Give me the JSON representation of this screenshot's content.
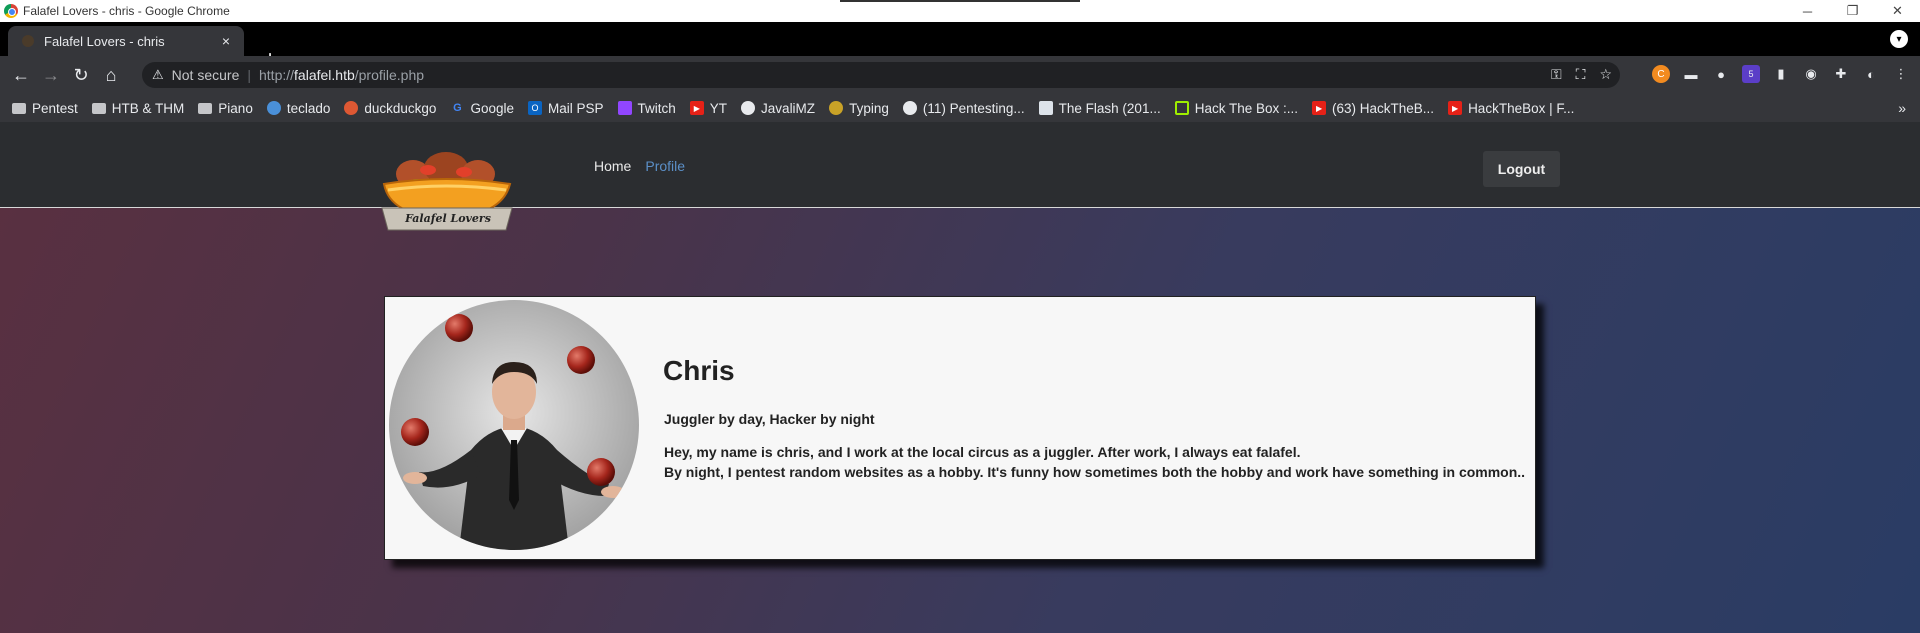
{
  "os": {
    "window_title": "Falafel Lovers - chris - Google Chrome",
    "min": "─",
    "restore": "❐",
    "close": "✕"
  },
  "browser": {
    "tab_title": "Falafel Lovers - chris",
    "tab_close": "×",
    "new_tab": "+",
    "security_label": "Not secure",
    "url_scheme": "http://",
    "url_host": "falafel.htb",
    "url_path": "/profile.php",
    "bookmarks": [
      {
        "label": "Pentest",
        "icon": "folder-icon"
      },
      {
        "label": "HTB & THM",
        "icon": "folder-icon"
      },
      {
        "label": "Piano",
        "icon": "folder-icon"
      },
      {
        "label": "teclado",
        "icon": "globe-icon"
      },
      {
        "label": "duckduckgo",
        "icon": "duckduckgo-icon"
      },
      {
        "label": "Google",
        "icon": "google-icon"
      },
      {
        "label": "Mail PSP",
        "icon": "outlook-icon"
      },
      {
        "label": "Twitch",
        "icon": "twitch-icon"
      },
      {
        "label": "YT",
        "icon": "youtube-icon"
      },
      {
        "label": "JavaliMZ",
        "icon": "github-icon"
      },
      {
        "label": "Typing",
        "icon": "typing-icon"
      },
      {
        "label": "(11) Pentesting...",
        "icon": "globe-icon"
      },
      {
        "label": "The Flash (201...",
        "icon": "film-icon"
      },
      {
        "label": "Hack The Box :...",
        "icon": "htb-icon"
      },
      {
        "label": "(63) HackTheB...",
        "icon": "youtube-icon"
      },
      {
        "label": "HackTheBox | F...",
        "icon": "youtube-icon"
      }
    ],
    "bookmarks_more": "»",
    "extension_badge": "5"
  },
  "site": {
    "nav": {
      "home": "Home",
      "profile": "Profile",
      "logout": "Logout"
    },
    "logo_text": "Falafel Lovers",
    "profile": {
      "name": "Chris",
      "tagline": "Juggler by day, Hacker by night",
      "bio_line1": "Hey, my name is chris, and I work at the local circus as a juggler. After work, I always eat falafel.",
      "bio_line2": "By night, I pentest random websites as a hobby. It's funny how sometimes both the hobby and work have something in common.."
    }
  },
  "colors": {
    "nav_bg": "#2b2d30",
    "link_active": "#5b8fc7",
    "card_bg": "#f7f7f7"
  }
}
